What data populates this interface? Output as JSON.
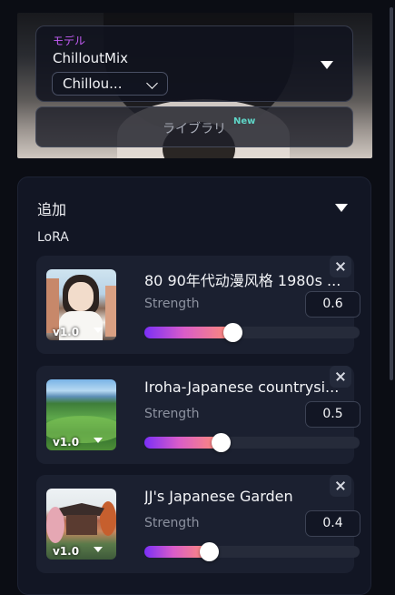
{
  "model": {
    "tag": "モデル",
    "name": "ChilloutMix",
    "version_value": "Chillou...",
    "library_label": "ライブラリ",
    "library_badge": "New"
  },
  "add_section": {
    "title": "追加",
    "lora_label": "LoRA"
  },
  "loras": [
    {
      "name": "80 90年代动漫风格 1980s ...",
      "strength_label": "Strength",
      "strength": "0.6",
      "strength_value": 0.6,
      "version": "v1.0"
    },
    {
      "name": "Iroha-Japanese countrysi...",
      "strength_label": "Strength",
      "strength": "0.5",
      "strength_value": 0.5,
      "version": "v1.0"
    },
    {
      "name": "JJ's Japanese Garden",
      "strength_label": "Strength",
      "strength": "0.4",
      "strength_value": 0.4,
      "version": "v1.0"
    }
  ],
  "icons": {
    "model_dropdown": "caret-down-icon",
    "version_dropdown": "chevron-down-icon",
    "section_toggle": "caret-down-icon",
    "remove": "close-icon"
  },
  "colors": {
    "accent_purple": "#c45cf6",
    "badge_teal": "#5fd6c8",
    "slider_start": "#7b2ff7",
    "slider_end": "#ff8e74"
  }
}
